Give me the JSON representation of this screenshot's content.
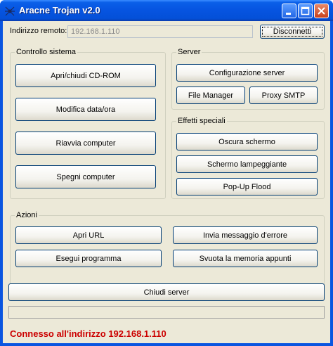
{
  "window": {
    "title": "Aracne Trojan v2.0"
  },
  "remote": {
    "label": "Indirizzo remoto:",
    "address": "192.168.1.110",
    "disconnect_label": "Disconnetti"
  },
  "system": {
    "legend": "Controllo sistema",
    "cdrom": "Apri/chiudi CD-ROM",
    "datetime": "Modifica data/ora",
    "restart": "Riavvia computer",
    "shutdown": "Spegni computer"
  },
  "server": {
    "legend": "Server",
    "config": "Configurazione server",
    "filemanager": "File Manager",
    "smtp": "Proxy SMTP"
  },
  "effects": {
    "legend": "Effetti speciali",
    "darken": "Oscura schermo",
    "flash": "Schermo lampeggiante",
    "popup": "Pop-Up Flood"
  },
  "actions": {
    "legend": "Azioni",
    "open_url": "Apri URL",
    "error_msg": "Invia messaggio d'errore",
    "run_program": "Esegui programma",
    "clear_clipboard": "Svuota la memoria appunti"
  },
  "close_server": "Chiudi server",
  "status": "Connesso all'indirizzo 192.168.1.110"
}
